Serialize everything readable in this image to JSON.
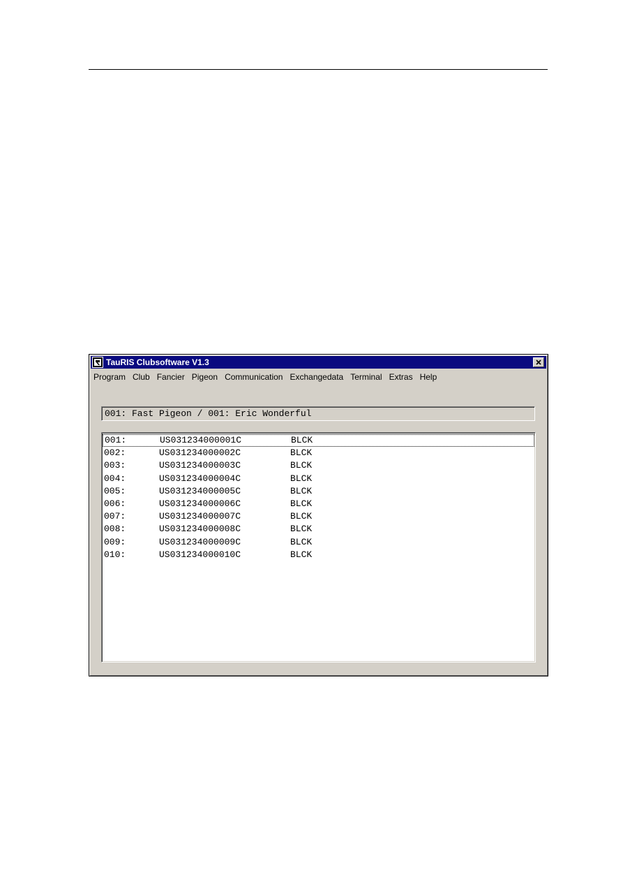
{
  "window": {
    "title": "TauRIS Clubsoftware  V1.3"
  },
  "menu": [
    "Program",
    "Club",
    "Fancier",
    "Pigeon",
    "Communication",
    "Exchangedata",
    "Terminal",
    "Extras",
    "Help"
  ],
  "header_field": {
    "value": "001: Fast Pigeon / 001: Eric Wonderful"
  },
  "pigeons": [
    {
      "num": "001:",
      "ring": "US031234000001C",
      "color": "BLCK"
    },
    {
      "num": "002:",
      "ring": "US031234000002C",
      "color": "BLCK"
    },
    {
      "num": "003:",
      "ring": "US031234000003C",
      "color": "BLCK"
    },
    {
      "num": "004:",
      "ring": "US031234000004C",
      "color": "BLCK"
    },
    {
      "num": "005:",
      "ring": "US031234000005C",
      "color": "BLCK"
    },
    {
      "num": "006:",
      "ring": "US031234000006C",
      "color": "BLCK"
    },
    {
      "num": "007:",
      "ring": "US031234000007C",
      "color": "BLCK"
    },
    {
      "num": "008:",
      "ring": "US031234000008C",
      "color": "BLCK"
    },
    {
      "num": "009:",
      "ring": "US031234000009C",
      "color": "BLCK"
    },
    {
      "num": "010:",
      "ring": "US031234000010C",
      "color": "BLCK"
    }
  ],
  "icons": {
    "app": "tauris-app-icon",
    "close": "close-icon"
  },
  "colors": {
    "titlebar": "#0a0a80",
    "window_face": "#d4d0c8",
    "list_background": "#ffffff"
  }
}
